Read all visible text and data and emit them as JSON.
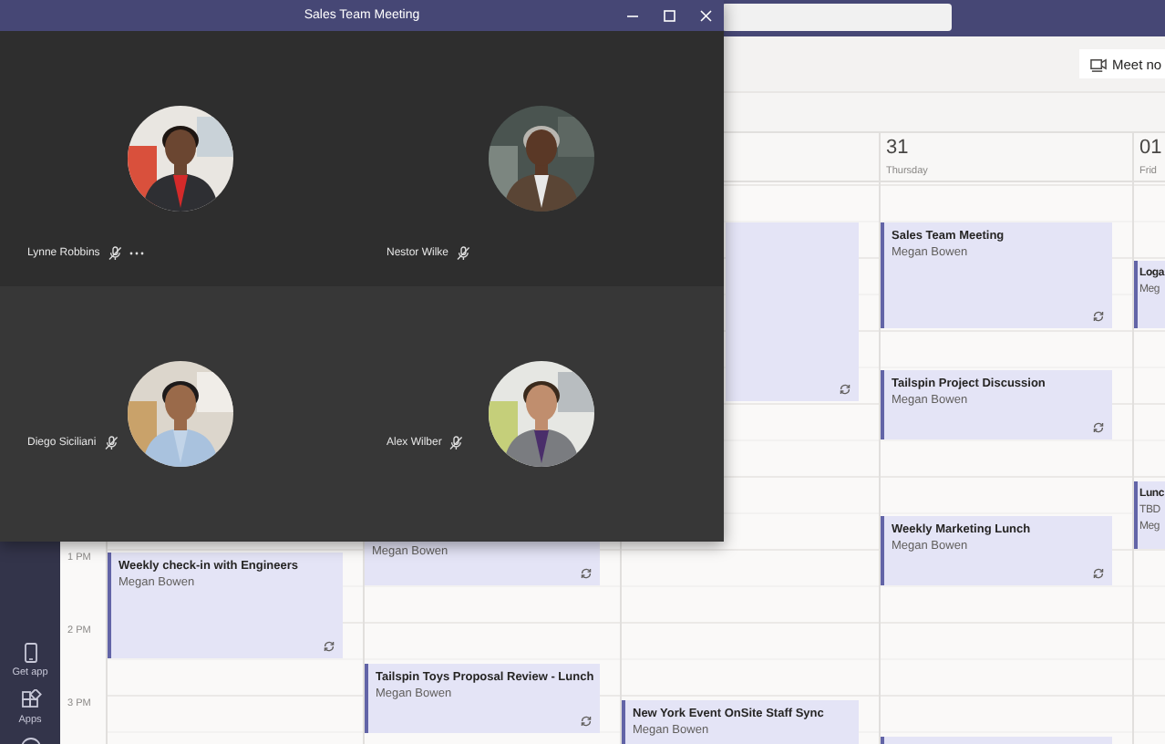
{
  "meeting": {
    "title": "Sales Team Meeting",
    "participants": [
      {
        "name": "Lynne Robbins",
        "muted": true,
        "more_options": true
      },
      {
        "name": "Nestor Wilke",
        "muted": true,
        "more_options": false
      },
      {
        "name": "Diego Siciliani",
        "muted": true,
        "more_options": false
      },
      {
        "name": "Alex Wilber",
        "muted": true,
        "more_options": false
      }
    ]
  },
  "rail": [
    {
      "kind": "phone",
      "label": "Get app"
    },
    {
      "kind": "apps",
      "label": "Apps"
    }
  ],
  "toolbar": {
    "meet_now": "Meet no"
  },
  "calendar": {
    "times": [
      "1 PM",
      "2 PM",
      "3 PM"
    ],
    "columns": [
      {
        "events": [
          {
            "title": "Weekly check-in with Engineers",
            "organizer": "Megan Bowen",
            "recurring": true
          }
        ]
      },
      {
        "events": [
          {
            "organizer": "Megan Bowen",
            "recurring": true
          },
          {
            "title": "Tailspin Toys Proposal Review - Lunch",
            "organizer": "Megan Bowen",
            "recurring": true
          }
        ]
      },
      {
        "events": [
          {
            "recurring": true
          },
          {
            "title": "New York Event OnSite Staff Sync",
            "organizer": "Megan Bowen",
            "recurring": false
          }
        ]
      },
      {
        "day": {
          "number": "31",
          "weekday": "Thursday"
        },
        "events": [
          {
            "title": "Sales Team Meeting",
            "organizer": "Megan Bowen",
            "recurring": true
          },
          {
            "title": "Tailspin Project Discussion",
            "organizer": "Megan Bowen",
            "recurring": true
          },
          {
            "title": "Weekly Marketing Lunch",
            "organizer": "Megan Bowen",
            "recurring": true
          },
          {
            "recurring": false
          }
        ]
      },
      {
        "day": {
          "number": "01",
          "weekday": "Frid"
        },
        "events": [
          {
            "title": "Loga",
            "organizer": "Meg",
            "recurring": false
          },
          {
            "title": "Lunc",
            "location": "TBD",
            "organizer": "Meg",
            "recurring": false
          }
        ]
      }
    ]
  }
}
